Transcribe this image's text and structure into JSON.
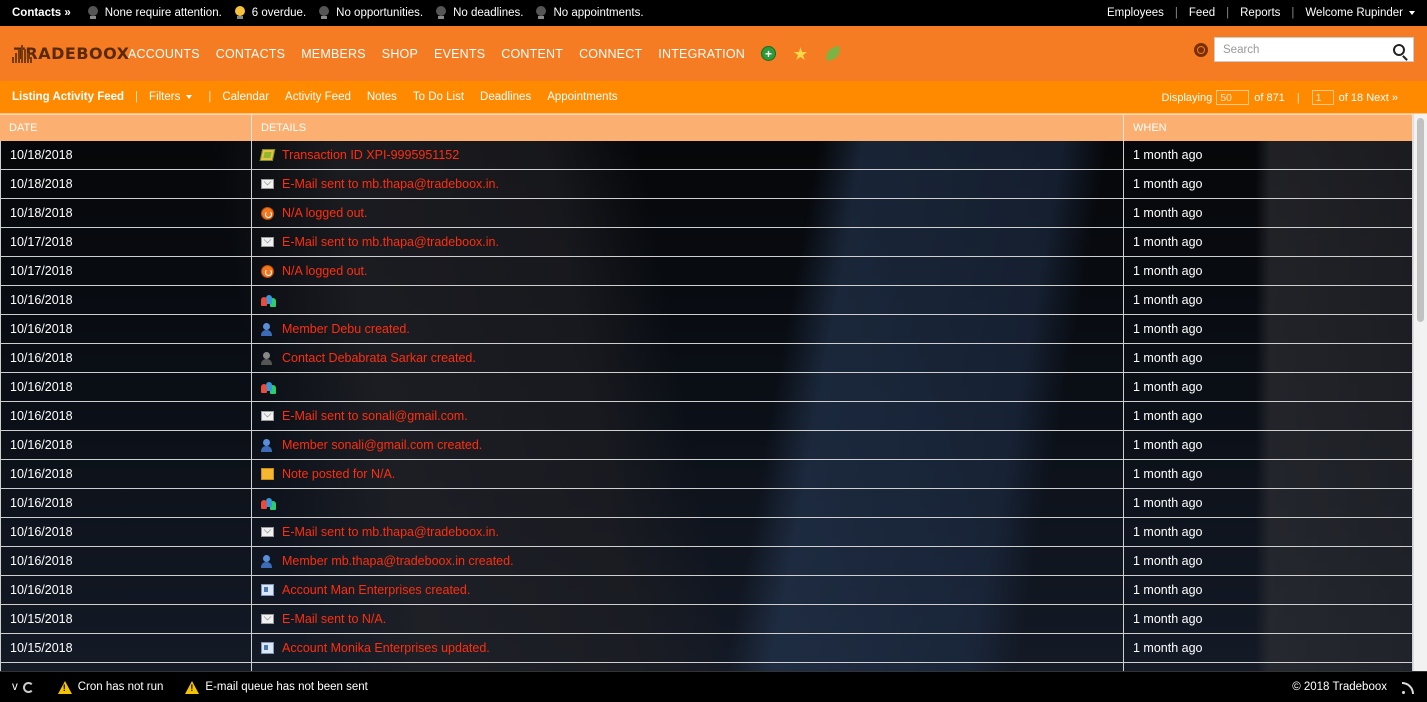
{
  "topbar": {
    "crumb": "Contacts »",
    "stats": [
      {
        "text": "None require attention.",
        "lit": false
      },
      {
        "text": "6 overdue.",
        "lit": true
      },
      {
        "text": "No opportunities.",
        "lit": false
      },
      {
        "text": "No deadlines.",
        "lit": false
      },
      {
        "text": "No appointments.",
        "lit": false
      }
    ],
    "links": {
      "employees": "Employees",
      "feed": "Feed",
      "reports": "Reports",
      "welcome": "Welcome Rupinder"
    }
  },
  "header": {
    "logo_text": "TRADEBOOX",
    "nav": [
      "ACCOUNTS",
      "CONTACTS",
      "MEMBERS",
      "SHOP",
      "EVENTS",
      "CONTENT",
      "CONNECT",
      "INTEGRATION"
    ],
    "search_placeholder": "Search",
    "accent_color": "#f57c22"
  },
  "subnav": {
    "active": "Listing Activity Feed",
    "filters": "Filters",
    "links": [
      "Calendar",
      "Activity Feed",
      "Notes",
      "To Do List",
      "Deadlines",
      "Appointments"
    ],
    "paging": {
      "displaying_label": "Displaying",
      "per_page": "50",
      "of_total": "of 871",
      "page": "1",
      "of_pages": "of 18",
      "next": "Next »"
    }
  },
  "table": {
    "headers": {
      "date": "DATE",
      "details": "DETAILS",
      "when": "WHEN"
    },
    "rows": [
      {
        "date": "10/18/2018",
        "icon": "money",
        "text": "Transaction ID XPI-9995951152",
        "when": "1 month ago"
      },
      {
        "date": "10/18/2018",
        "icon": "mail",
        "text": "E-Mail sent to mb.thapa@tradeboox.in.",
        "when": "1 month ago"
      },
      {
        "date": "10/18/2018",
        "icon": "power",
        "text": "N/A logged out.",
        "when": "1 month ago"
      },
      {
        "date": "10/17/2018",
        "icon": "mail",
        "text": "E-Mail sent to mb.thapa@tradeboox.in.",
        "when": "1 month ago"
      },
      {
        "date": "10/17/2018",
        "icon": "power",
        "text": "N/A logged out.",
        "when": "1 month ago"
      },
      {
        "date": "10/16/2018",
        "icon": "group",
        "text": "",
        "when": "1 month ago"
      },
      {
        "date": "10/16/2018",
        "icon": "member",
        "text": "Member Debu created.",
        "when": "1 month ago"
      },
      {
        "date": "10/16/2018",
        "icon": "contact",
        "text": "Contact Debabrata Sarkar created.",
        "when": "1 month ago"
      },
      {
        "date": "10/16/2018",
        "icon": "group",
        "text": "",
        "when": "1 month ago"
      },
      {
        "date": "10/16/2018",
        "icon": "mail",
        "text": "E-Mail sent to sonali@gmail.com.",
        "when": "1 month ago"
      },
      {
        "date": "10/16/2018",
        "icon": "member",
        "text": "Member sonali@gmail.com created.",
        "when": "1 month ago"
      },
      {
        "date": "10/16/2018",
        "icon": "note",
        "text": "Note posted for N/A.",
        "when": "1 month ago"
      },
      {
        "date": "10/16/2018",
        "icon": "group",
        "text": "",
        "when": "1 month ago"
      },
      {
        "date": "10/16/2018",
        "icon": "mail",
        "text": "E-Mail sent to mb.thapa@tradeboox.in.",
        "when": "1 month ago"
      },
      {
        "date": "10/16/2018",
        "icon": "member",
        "text": "Member mb.thapa@tradeboox.in created.",
        "when": "1 month ago"
      },
      {
        "date": "10/16/2018",
        "icon": "account",
        "text": "Account Man Enterprises created.",
        "when": "1 month ago"
      },
      {
        "date": "10/15/2018",
        "icon": "mail",
        "text": "E-Mail sent to N/A.",
        "when": "1 month ago"
      },
      {
        "date": "10/15/2018",
        "icon": "account",
        "text": "Account Monika Enterprises updated.",
        "when": "1 month ago"
      }
    ]
  },
  "footer": {
    "version": "v",
    "cron": "Cron has not run",
    "email_queue": "E-mail queue has not been sent",
    "copyright": "© 2018 Tradeboox"
  }
}
